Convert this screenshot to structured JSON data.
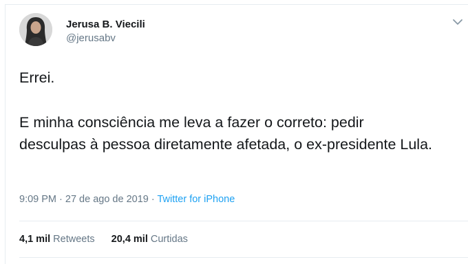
{
  "tweet": {
    "author_name": "Jerusa B. Viecili",
    "author_handle": "@jerusabv",
    "text_lines": [
      "Errei.",
      "E minha consciência me leva a fazer o correto: pedir desculpas à pessoa diretamente afetada, o ex-presidente Lula."
    ],
    "timestamp": "9:09 PM · 27 de ago de 2019",
    "separator": " · ",
    "source": "Twitter for iPhone",
    "stats": {
      "retweets_count": "4,1 mil",
      "retweets_label": "Retweets",
      "likes_count": "20,4 mil",
      "likes_label": "Curtidas"
    },
    "icons": {
      "menu": "chevron-down-icon"
    },
    "colors": {
      "link": "#1da1f2",
      "secondary_text": "#657786",
      "primary_text": "#14171a"
    }
  }
}
